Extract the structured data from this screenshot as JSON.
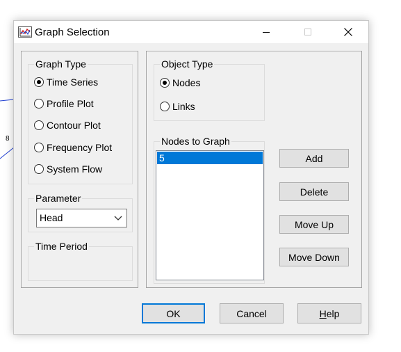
{
  "window": {
    "title": "Graph Selection",
    "icon": "graph-icon",
    "minimize_icon": "minimize-icon",
    "maximize_icon": "maximize-icon",
    "close_icon": "close-icon"
  },
  "graph_type": {
    "title": "Graph Type",
    "options": [
      "Time Series",
      "Profile Plot",
      "Contour Plot",
      "Frequency Plot",
      "System Flow"
    ],
    "selected": "Time Series"
  },
  "parameter": {
    "title": "Parameter",
    "value": "Head"
  },
  "time_period": {
    "title": "Time Period"
  },
  "object_type": {
    "title": "Object Type",
    "options": [
      "Nodes",
      "Links"
    ],
    "selected": "Nodes"
  },
  "nodes_to_graph": {
    "title": "Nodes to Graph",
    "items": [
      "5"
    ]
  },
  "side_buttons": {
    "add": "Add",
    "delete": "Delete",
    "move_up": "Move Up",
    "move_down": "Move Down"
  },
  "footer_buttons": {
    "ok": "OK",
    "cancel": "Cancel",
    "help": "Help"
  },
  "background": {
    "label": "8",
    "line_color": "#1f3fd1"
  },
  "colors": {
    "selection": "#0078d7",
    "default_border": "#0078d7"
  }
}
